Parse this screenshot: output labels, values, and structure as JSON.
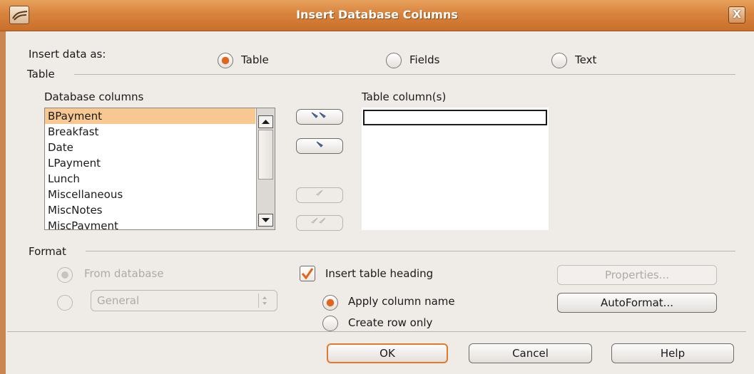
{
  "window": {
    "title": "Insert Database Columns",
    "close_label": "X"
  },
  "insert_as": {
    "label": "Insert data as:",
    "options": [
      {
        "label": "Table",
        "selected": true
      },
      {
        "label": "Fields",
        "selected": false
      },
      {
        "label": "Text",
        "selected": false
      }
    ]
  },
  "table_section": {
    "title": "Table",
    "db_columns_label": "Database columns",
    "db_columns": [
      "BPayment",
      "Breakfast",
      "Date",
      "LPayment",
      "Lunch",
      "Miscellaneous",
      "MiscNotes",
      "MiscPayment"
    ],
    "selected_column": "BPayment",
    "table_columns_label": "Table column(s)",
    "table_columns": []
  },
  "format_section": {
    "title": "Format",
    "from_database_label": "From database",
    "format_combo_value": "General",
    "insert_heading_label": "Insert table heading",
    "insert_heading_checked": true,
    "apply_column_name_label": "Apply column name",
    "create_row_only_label": "Create row only",
    "properties_label": "Properties...",
    "autoformat_label": "AutoFormat..."
  },
  "buttons": {
    "ok": "OK",
    "cancel": "Cancel",
    "help": "Help"
  },
  "colors": {
    "titlebar": "#d8833d",
    "accent": "#e0651b",
    "selection": "#f8c892"
  }
}
